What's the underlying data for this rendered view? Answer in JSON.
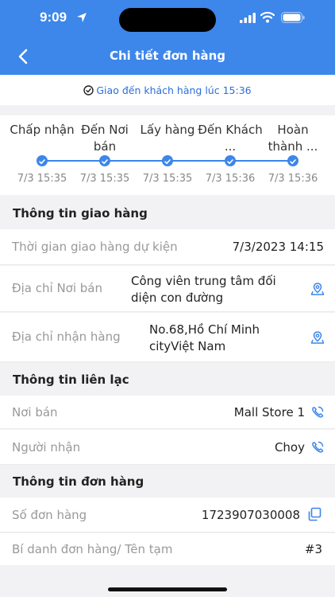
{
  "status_bar": {
    "time": "9:09"
  },
  "header": {
    "title": "Chi tiết đơn hàng"
  },
  "delivered": {
    "text": "Giao đến khách hàng lúc 15:36"
  },
  "timeline": [
    {
      "label": "Chấp nhận",
      "date": "7/3 15:35"
    },
    {
      "label": "Đến Nơi bán",
      "date": "7/3 15:35"
    },
    {
      "label": "Lấy hàng",
      "date": "7/3 15:35"
    },
    {
      "label": "Đến Khách ...",
      "date": "7/3 15:36"
    },
    {
      "label": "Hoàn thành ...",
      "date": "7/3 15:36"
    }
  ],
  "delivery_info": {
    "title": "Thông tin giao hàng",
    "expected_time_label": "Thời gian giao hàng dự kiện",
    "expected_time_value": "7/3/2023 14:15",
    "seller_address_label": "Địa chỉ Nơi bán",
    "seller_address_value": "Công viên trung tâm đối diện con đường",
    "receiver_address_label": "Địa chỉ nhận hàng",
    "receiver_address_value": "No.68,Hồ Chí Minh cityViệt Nam"
  },
  "contact_info": {
    "title": "Thông tin liên lạc",
    "seller_label": "Nơi bán",
    "seller_value": "Mall Store 1",
    "receiver_label": "Người nhận",
    "receiver_value": "Choy"
  },
  "order_info": {
    "title": "Thông tin đơn hàng",
    "order_no_label": "Số đơn hàng",
    "order_no_value": "1723907030008",
    "alias_label": "Bí danh đơn hàng/ Tên tạm",
    "alias_value": "#3"
  },
  "colors": {
    "accent": "#3d86ea",
    "link": "#2a6fd8"
  }
}
